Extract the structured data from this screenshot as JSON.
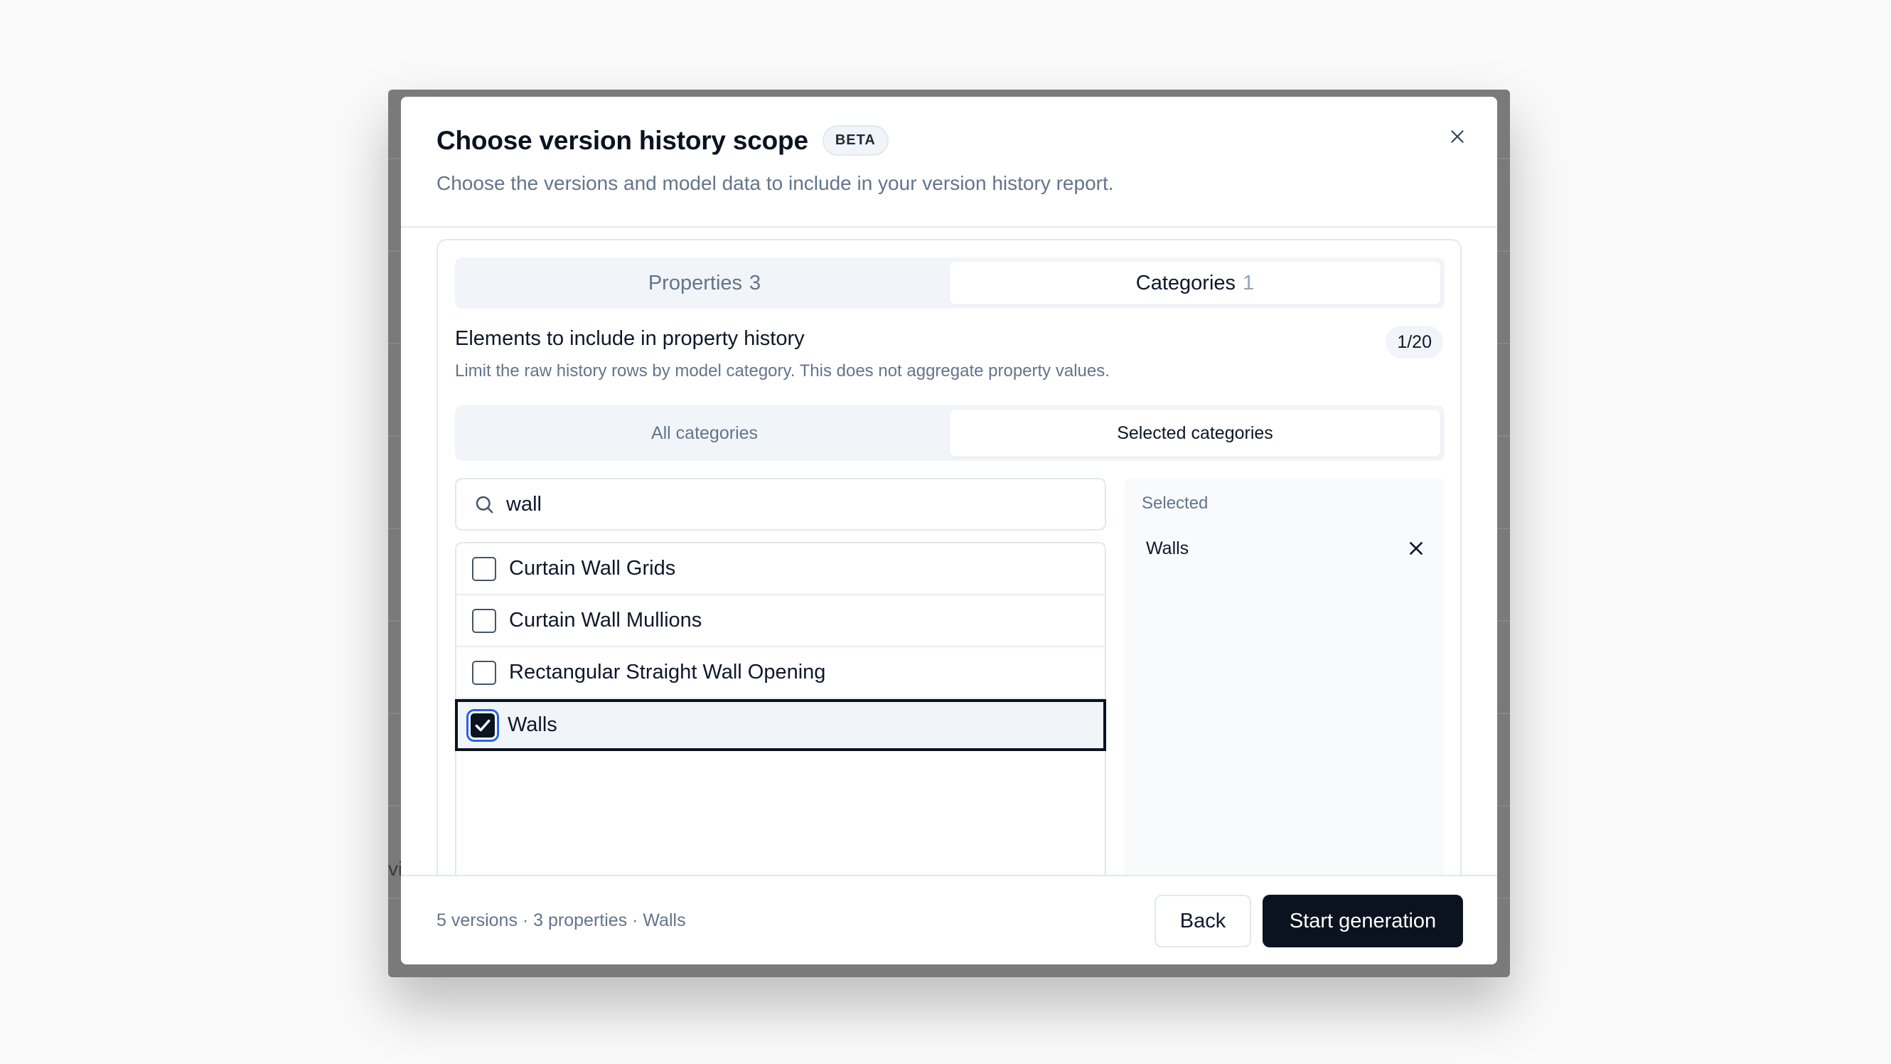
{
  "background": {
    "stub_text": "vi"
  },
  "header": {
    "title": "Choose version history scope",
    "badge": "BETA",
    "subtitle": "Choose the versions and model data to include in your version history report.",
    "close_icon": "close-icon"
  },
  "tabs": [
    {
      "label": "Properties",
      "count": "3",
      "active": false
    },
    {
      "label": "Categories",
      "count": "1",
      "active": true
    }
  ],
  "section": {
    "title": "Elements to include in property history",
    "description": "Limit the raw history rows by model category. This does not aggregate property values.",
    "counter": "1/20"
  },
  "filter_tabs": [
    {
      "label": "All categories",
      "active": false
    },
    {
      "label": "Selected categories",
      "active": true
    }
  ],
  "search": {
    "value": "wall",
    "icon": "search-icon"
  },
  "categories": [
    {
      "label": "Curtain Wall Grids",
      "checked": false
    },
    {
      "label": "Curtain Wall Mullions",
      "checked": false
    },
    {
      "label": "Rectangular Straight Wall Opening",
      "checked": false
    },
    {
      "label": "Walls",
      "checked": true
    }
  ],
  "selected_panel": {
    "heading": "Selected",
    "items": [
      "Walls"
    ]
  },
  "footer": {
    "summary": "5 versions · 3 properties · Walls",
    "back_label": "Back",
    "start_label": "Start generation"
  },
  "colors": {
    "primary": "#0b1220",
    "muted": "#64748b",
    "focus_ring": "#2563eb"
  }
}
